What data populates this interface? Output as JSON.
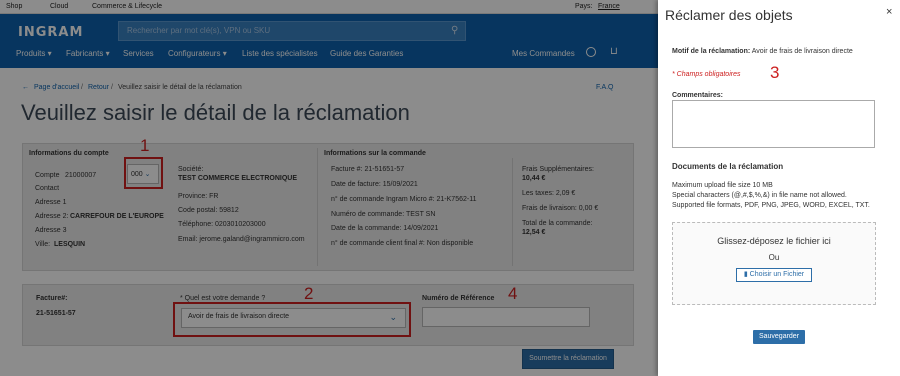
{
  "topbar": {
    "links": [
      "Shop",
      "Cloud",
      "Commerce & Lifecycle"
    ],
    "country_label": "Pays:",
    "country_value": "France"
  },
  "header": {
    "logo": "INGRAM",
    "search_placeholder": "Rechercher par mot clé(s), VPN ou SKU",
    "nav": [
      "Produits",
      "Fabricants",
      "Services",
      "Configurateurs",
      "Liste des spécialistes",
      "Guide des Garanties"
    ],
    "my_orders": "Mes Commandes"
  },
  "breadcrumb": {
    "home": "Page d'accueil",
    "back": "Retour",
    "current": "Veuillez saisir le détail de la réclamation",
    "faq": "F.A.Q"
  },
  "page_title": "Veuillez saisir le détail de la réclamation",
  "account": {
    "heading": "Informations du compte",
    "account_label": "Compte",
    "account_value": "21000007",
    "select_value": "000",
    "contact_label": "Contact",
    "addr1_label": "Adresse 1",
    "addr2_label": "Adresse 2:",
    "addr2_value": "CARREFOUR DE L'EUROPE",
    "addr3_label": "Adresse 3",
    "city_label": "Ville:",
    "city_value": "LESQUIN",
    "company_label": "Société:",
    "company_value": "TEST COMMERCE ELECTRONIQUE",
    "province": "Province: FR",
    "postal": "Code postal: 59812",
    "phone": "Téléphone: 0203010203000",
    "email": "Email: jerome.galand@ingrammicro.com"
  },
  "order": {
    "heading": "Informations sur la commande",
    "invoice": "Facture #: 21-51651-57",
    "invoice_date": "Date de facture: 15/09/2021",
    "ingram_order": "n° de commande Ingram Micro #: 21-K7562-11",
    "order_number": "Numéro de commande: TEST SN",
    "order_date": "Date de la commande: 14/09/2021",
    "client_order": "n° de commande client final #: Non disponible",
    "extra_label": "Frais Supplémentaires:",
    "extra_value": "10,44 €",
    "taxes": "Les taxes: 2,09 €",
    "shipping": "Frais de livraison: 0,00 €",
    "total_label": "Total de la commande:",
    "total_value": "12,54 €"
  },
  "claim": {
    "invoice_label": "Facture#:",
    "invoice_value": "21-51651-57",
    "request_label": "* Quel est votre demande ?",
    "request_value": "Avoir de frais de livraison directe",
    "reference_label": "Numéro de Référence",
    "submit": "Soumettre la réclamation"
  },
  "annotations": [
    "1",
    "2",
    "3",
    "4"
  ],
  "drawer": {
    "title": "Réclamer des objets",
    "close": "×",
    "reason_label": "Motif de la réclamation:",
    "reason_value": "Avoir de frais de livraison directe",
    "required": "* Champs obligatoires",
    "comments_label": "Commentaires:",
    "docs_heading": "Documents de la réclamation",
    "upload_rules": [
      "Maximum upload file size 10 MB",
      "Special characters (@,#,$,%,&) in file name not allowed.",
      "Supported file formats, PDF, PNG, JPEG, WORD, EXCEL, TXT."
    ],
    "drop_text": "Glissez-déposez le fichier ici",
    "or_text": "Ou",
    "choose_file": "Choisir un Fichier",
    "save": "Sauvegarder"
  }
}
